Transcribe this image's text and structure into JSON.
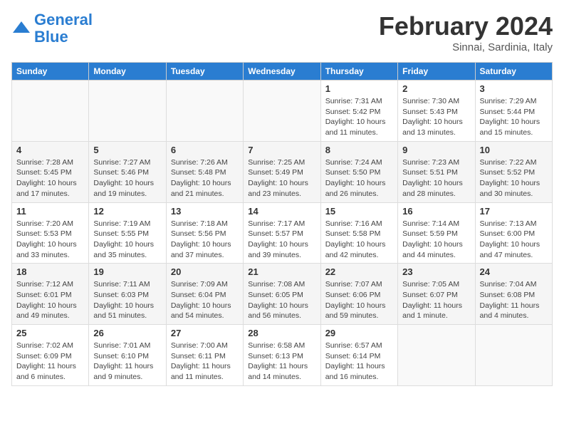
{
  "header": {
    "logo_general": "General",
    "logo_blue": "Blue",
    "title": "February 2024",
    "subtitle": "Sinnai, Sardinia, Italy"
  },
  "columns": [
    "Sunday",
    "Monday",
    "Tuesday",
    "Wednesday",
    "Thursday",
    "Friday",
    "Saturday"
  ],
  "weeks": [
    [
      {
        "day": "",
        "info": ""
      },
      {
        "day": "",
        "info": ""
      },
      {
        "day": "",
        "info": ""
      },
      {
        "day": "",
        "info": ""
      },
      {
        "day": "1",
        "info": "Sunrise: 7:31 AM\nSunset: 5:42 PM\nDaylight: 10 hours\nand 11 minutes."
      },
      {
        "day": "2",
        "info": "Sunrise: 7:30 AM\nSunset: 5:43 PM\nDaylight: 10 hours\nand 13 minutes."
      },
      {
        "day": "3",
        "info": "Sunrise: 7:29 AM\nSunset: 5:44 PM\nDaylight: 10 hours\nand 15 minutes."
      }
    ],
    [
      {
        "day": "4",
        "info": "Sunrise: 7:28 AM\nSunset: 5:45 PM\nDaylight: 10 hours\nand 17 minutes."
      },
      {
        "day": "5",
        "info": "Sunrise: 7:27 AM\nSunset: 5:46 PM\nDaylight: 10 hours\nand 19 minutes."
      },
      {
        "day": "6",
        "info": "Sunrise: 7:26 AM\nSunset: 5:48 PM\nDaylight: 10 hours\nand 21 minutes."
      },
      {
        "day": "7",
        "info": "Sunrise: 7:25 AM\nSunset: 5:49 PM\nDaylight: 10 hours\nand 23 minutes."
      },
      {
        "day": "8",
        "info": "Sunrise: 7:24 AM\nSunset: 5:50 PM\nDaylight: 10 hours\nand 26 minutes."
      },
      {
        "day": "9",
        "info": "Sunrise: 7:23 AM\nSunset: 5:51 PM\nDaylight: 10 hours\nand 28 minutes."
      },
      {
        "day": "10",
        "info": "Sunrise: 7:22 AM\nSunset: 5:52 PM\nDaylight: 10 hours\nand 30 minutes."
      }
    ],
    [
      {
        "day": "11",
        "info": "Sunrise: 7:20 AM\nSunset: 5:53 PM\nDaylight: 10 hours\nand 33 minutes."
      },
      {
        "day": "12",
        "info": "Sunrise: 7:19 AM\nSunset: 5:55 PM\nDaylight: 10 hours\nand 35 minutes."
      },
      {
        "day": "13",
        "info": "Sunrise: 7:18 AM\nSunset: 5:56 PM\nDaylight: 10 hours\nand 37 minutes."
      },
      {
        "day": "14",
        "info": "Sunrise: 7:17 AM\nSunset: 5:57 PM\nDaylight: 10 hours\nand 39 minutes."
      },
      {
        "day": "15",
        "info": "Sunrise: 7:16 AM\nSunset: 5:58 PM\nDaylight: 10 hours\nand 42 minutes."
      },
      {
        "day": "16",
        "info": "Sunrise: 7:14 AM\nSunset: 5:59 PM\nDaylight: 10 hours\nand 44 minutes."
      },
      {
        "day": "17",
        "info": "Sunrise: 7:13 AM\nSunset: 6:00 PM\nDaylight: 10 hours\nand 47 minutes."
      }
    ],
    [
      {
        "day": "18",
        "info": "Sunrise: 7:12 AM\nSunset: 6:01 PM\nDaylight: 10 hours\nand 49 minutes."
      },
      {
        "day": "19",
        "info": "Sunrise: 7:11 AM\nSunset: 6:03 PM\nDaylight: 10 hours\nand 51 minutes."
      },
      {
        "day": "20",
        "info": "Sunrise: 7:09 AM\nSunset: 6:04 PM\nDaylight: 10 hours\nand 54 minutes."
      },
      {
        "day": "21",
        "info": "Sunrise: 7:08 AM\nSunset: 6:05 PM\nDaylight: 10 hours\nand 56 minutes."
      },
      {
        "day": "22",
        "info": "Sunrise: 7:07 AM\nSunset: 6:06 PM\nDaylight: 10 hours\nand 59 minutes."
      },
      {
        "day": "23",
        "info": "Sunrise: 7:05 AM\nSunset: 6:07 PM\nDaylight: 11 hours\nand 1 minute."
      },
      {
        "day": "24",
        "info": "Sunrise: 7:04 AM\nSunset: 6:08 PM\nDaylight: 11 hours\nand 4 minutes."
      }
    ],
    [
      {
        "day": "25",
        "info": "Sunrise: 7:02 AM\nSunset: 6:09 PM\nDaylight: 11 hours\nand 6 minutes."
      },
      {
        "day": "26",
        "info": "Sunrise: 7:01 AM\nSunset: 6:10 PM\nDaylight: 11 hours\nand 9 minutes."
      },
      {
        "day": "27",
        "info": "Sunrise: 7:00 AM\nSunset: 6:11 PM\nDaylight: 11 hours\nand 11 minutes."
      },
      {
        "day": "28",
        "info": "Sunrise: 6:58 AM\nSunset: 6:13 PM\nDaylight: 11 hours\nand 14 minutes."
      },
      {
        "day": "29",
        "info": "Sunrise: 6:57 AM\nSunset: 6:14 PM\nDaylight: 11 hours\nand 16 minutes."
      },
      {
        "day": "",
        "info": ""
      },
      {
        "day": "",
        "info": ""
      }
    ]
  ]
}
